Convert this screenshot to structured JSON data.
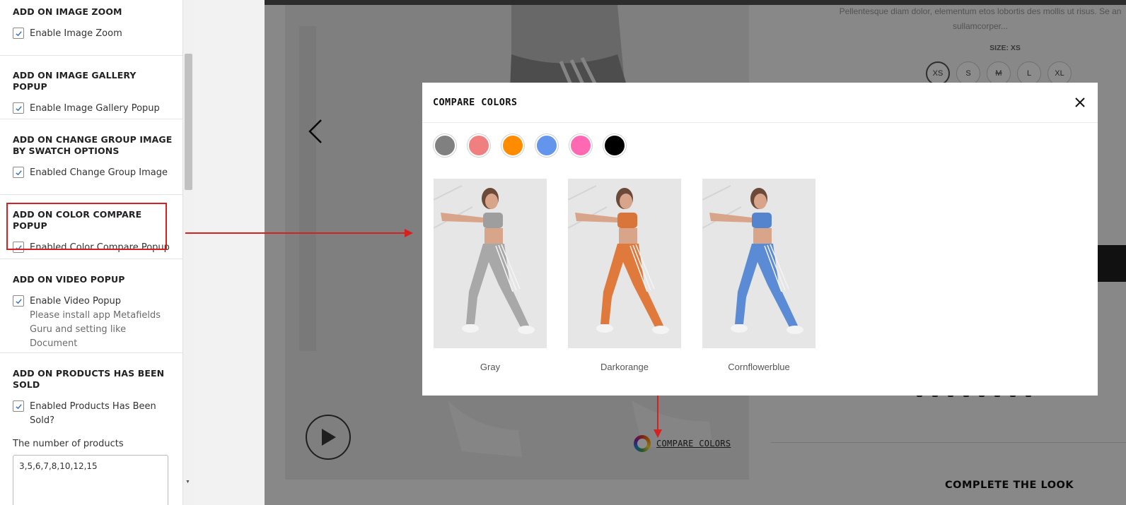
{
  "settings": {
    "sections": [
      {
        "title": "ADD ON IMAGE ZOOM",
        "checkbox": "Enable Image Zoom"
      },
      {
        "title": "ADD ON IMAGE GALLERY POPUP",
        "checkbox": "Enable Image Gallery Popup"
      },
      {
        "title": "ADD ON CHANGE GROUP IMAGE BY SWATCH OPTIONS",
        "checkbox": "Enabled Change Group Image"
      },
      {
        "title": "ADD ON COLOR COMPARE POPUP",
        "checkbox": "Enabled Color Compare Popup"
      },
      {
        "title": "ADD ON VIDEO POPUP",
        "checkbox": "Enable Video Popup",
        "note": "Please install app Metafields Guru and setting like Document"
      },
      {
        "title": "ADD ON PRODUCTS HAS BEEN SOLD",
        "checkbox": "Enabled Products Has Been Sold?",
        "field_label": "The number of products",
        "field_value": "3,5,6,7,8,10,12,15"
      }
    ]
  },
  "product": {
    "description": "Pellentesque diam dolor, elementum etos lobortis des mollis ut risus. Se an sullamcorper...",
    "size_label": "SIZE: XS",
    "sizes": [
      "XS",
      "S",
      "M",
      "L",
      "XL"
    ],
    "compare_link": "COMPARE COLORS",
    "complete_the_look": "COMPLETE THE LOOK"
  },
  "modal": {
    "title": "COMPARE COLORS",
    "swatches": [
      {
        "name": "gray",
        "color": "#808080"
      },
      {
        "name": "lightcoral",
        "color": "#f08080"
      },
      {
        "name": "darkorange",
        "color": "#ff8c00"
      },
      {
        "name": "cornflowerblue",
        "color": "#6495ed"
      },
      {
        "name": "hotpink",
        "color": "#ff69b4"
      },
      {
        "name": "black",
        "color": "#000000"
      }
    ],
    "cards": [
      {
        "label": "Gray",
        "color": "#a8a8a8",
        "top": "#9e9e9e"
      },
      {
        "label": "Darkorange",
        "color": "#e07a3c",
        "top": "#d9743a"
      },
      {
        "label": "Cornflowerblue",
        "color": "#5b8bd4",
        "top": "#5584cf"
      }
    ]
  },
  "colors": {
    "annotation": "#d62121"
  }
}
